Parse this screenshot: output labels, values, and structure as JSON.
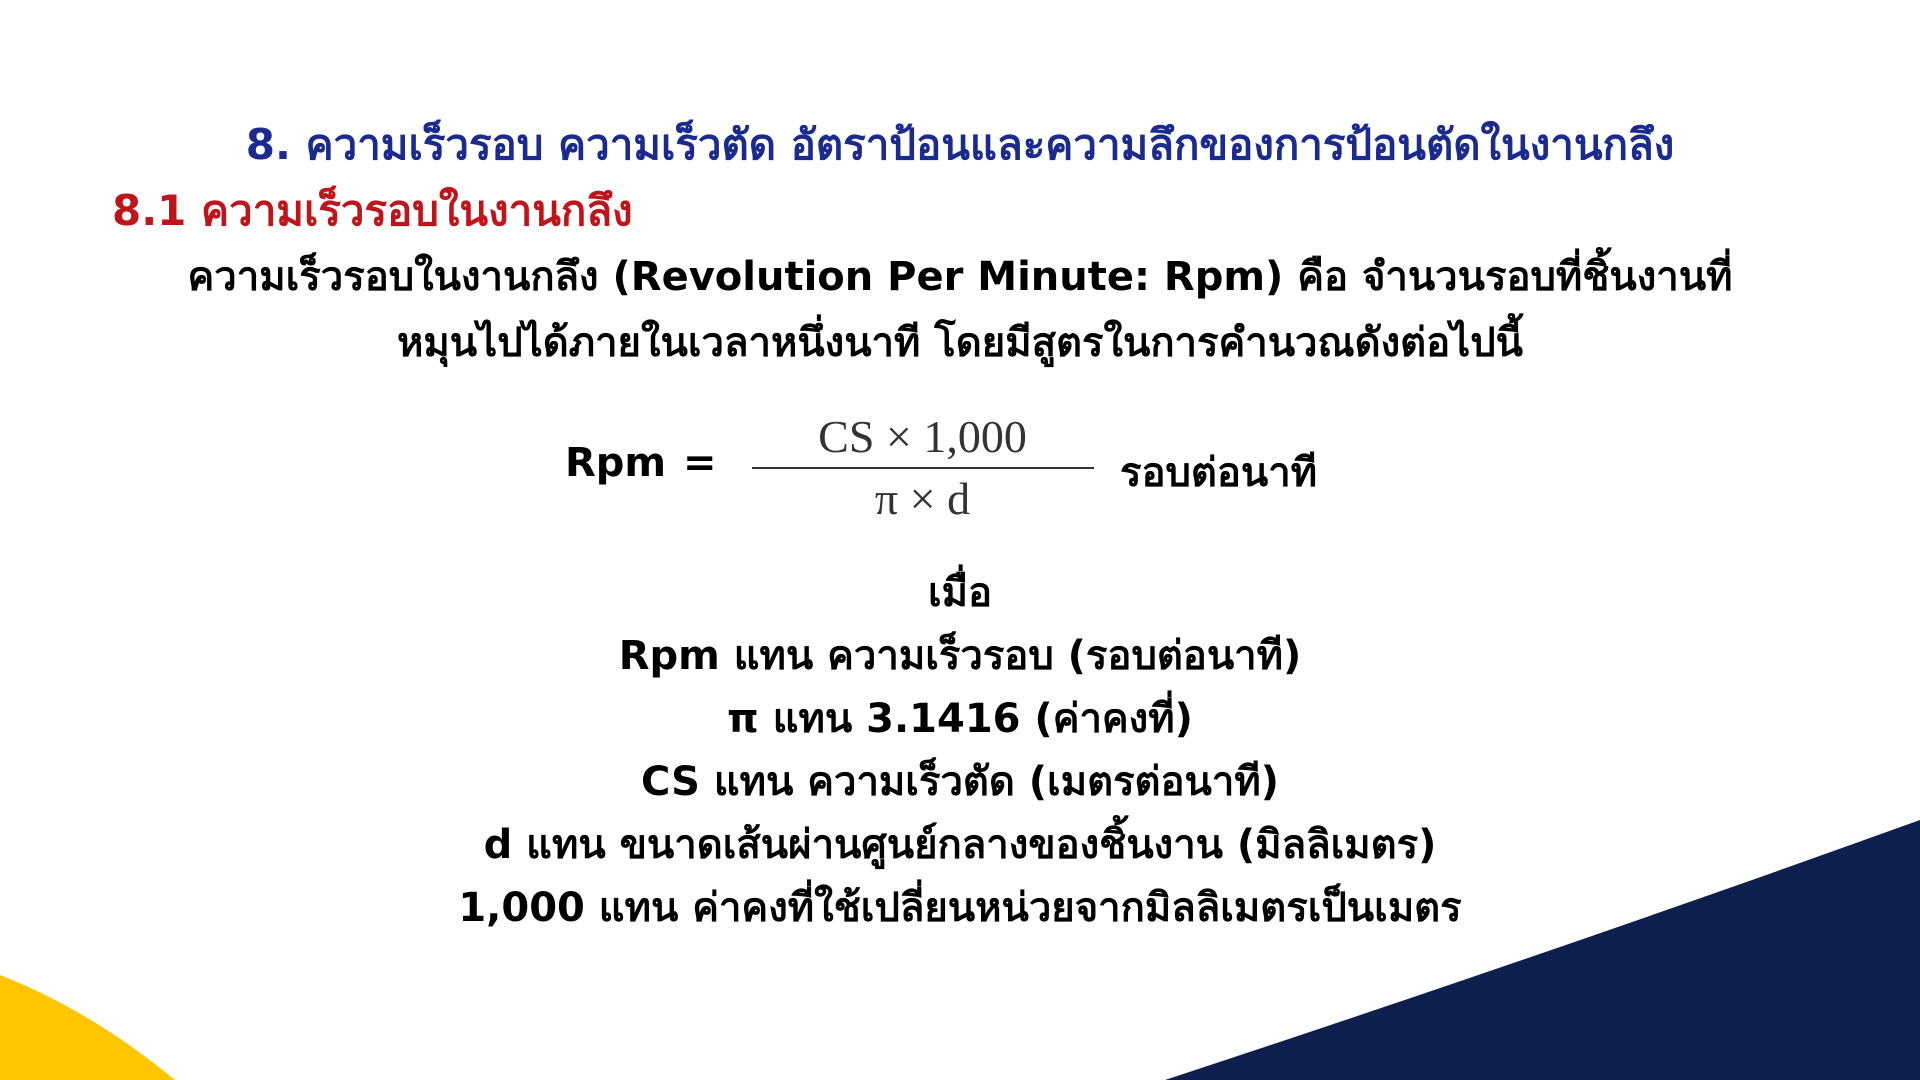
{
  "slide": {
    "heading": "8. ความเร็วรอบ ความเร็วตัด อัตราป้อนและความลึกของการป้อนตัดในงานกลึง",
    "subheading": "8.1 ความเร็วรอบในงานกลึง",
    "definition": [
      "ความเร็วรอบในงานกลึง (Revolution Per Minute: Rpm) คือ จำนวนรอบที่ชิ้นงานที่",
      "หมุนไปได้ภายในเวลาหนึ่งนาที โดยมีสูตรในการคำนวณดังต่อไปนี้"
    ],
    "formula": {
      "lhs": "Rpm",
      "equals": "=",
      "numerator": "CS × 1,000",
      "denominator": "π × d",
      "unit": "รอบต่อนาที"
    },
    "where": {
      "title": "เมื่อ",
      "lines": [
        "Rpm แทน ความเร็วรอบ (รอบต่อนาที)",
        "π แทน 3.1416 (ค่าคงที่)",
        "CS แทน ความเร็วตัด (เมตรต่อนาที)",
        "d แทน ขนาดเส้นผ่านศูนย์กลางของชิ้นงาน (มิลลิเมตร)",
        "1,000 แทน ค่าคงที่ใช้เปลี่ยนหน่วยจากมิลลิเมตรเป็นเมตร"
      ]
    },
    "colors": {
      "heading": "#1b2a8f",
      "subheading": "#c0141b",
      "accent_yellow": "#ffc600",
      "accent_navy": "#0f1f4d"
    }
  }
}
